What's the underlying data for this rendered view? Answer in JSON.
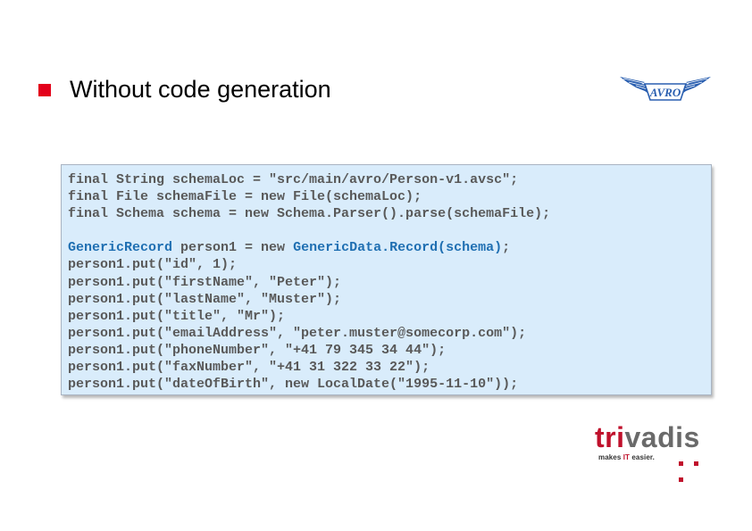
{
  "slide": {
    "title": "Without code generation",
    "accent_color": "#e3001b"
  },
  "avro_logo": {
    "text": "AVRO",
    "color": "#2a5fb0"
  },
  "code": {
    "line1": "final String schemaLoc = \"src/main/avro/Person-v1.avsc\";",
    "line2": "final File schemaFile = new File(schemaLoc);",
    "line3": "final Schema schema = new Schema.Parser().parse(schemaFile);",
    "line5": {
      "t1": "GenericRecord",
      "t2": " person1 = new ",
      "t3": "GenericData.Record(schema)",
      "t4": ";"
    },
    "line6": "person1.put(\"id\", 1);",
    "line7": "person1.put(\"firstName\", \"Peter\");",
    "line8": "person1.put(\"lastName\", \"Muster\");",
    "line9": "person1.put(\"title\", \"Mr\");",
    "line10": "person1.put(\"emailAddress\", \"peter.muster@somecorp.com\");",
    "line11": "person1.put(\"phoneNumber\", \"+41 79 345 34 44\");",
    "line12": "person1.put(\"faxNumber\", \"+41 31 322 33 22\");",
    "line13": "person1.put(\"dateOfBirth\", new LocalDate(\"1995-11-10\"));",
    "text_color": "#595959",
    "keyword_color": "#1f6fb2",
    "background_color": "#d9ecfb"
  },
  "brand": {
    "name_part1": "tri",
    "name_part2": "vadis",
    "tagline_part1": "makes ",
    "tagline_part2": "IT",
    "tagline_part3": " easier.",
    "red": "#c0112c",
    "grey": "#6a6a6a"
  }
}
